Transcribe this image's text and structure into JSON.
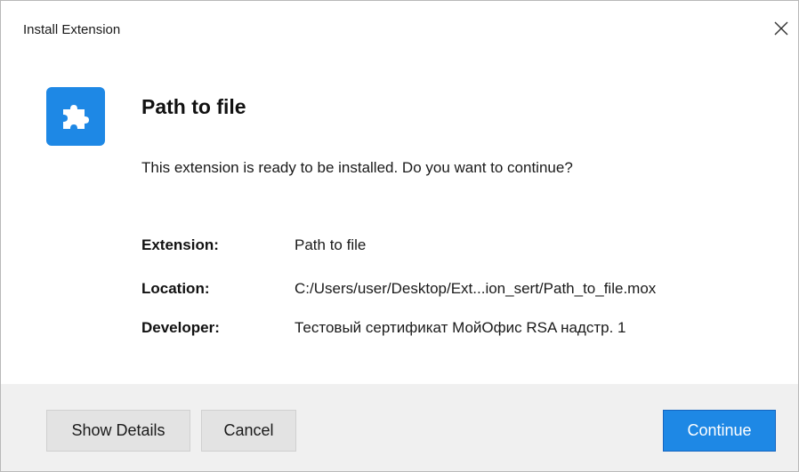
{
  "window": {
    "title": "Install Extension",
    "close_icon": "close-icon"
  },
  "extension": {
    "icon": "puzzle-piece-icon",
    "icon_bg_color": "#1e88e5",
    "name": "Path to file",
    "prompt": "This extension is ready to be installed. Do you want to continue?"
  },
  "details": [
    {
      "label": "Extension:",
      "value": "Path to file"
    },
    {
      "label": "Location:",
      "value": "C:/Users/user/Desktop/Ext...ion_sert/Path_to_file.mox"
    },
    {
      "label": "Developer:",
      "value": "Тестовый сертификат МойОфис RSA надстр. 1"
    }
  ],
  "buttons": {
    "show_details": "Show Details",
    "cancel": "Cancel",
    "continue": "Continue",
    "continue_color": "#1e88e5"
  }
}
